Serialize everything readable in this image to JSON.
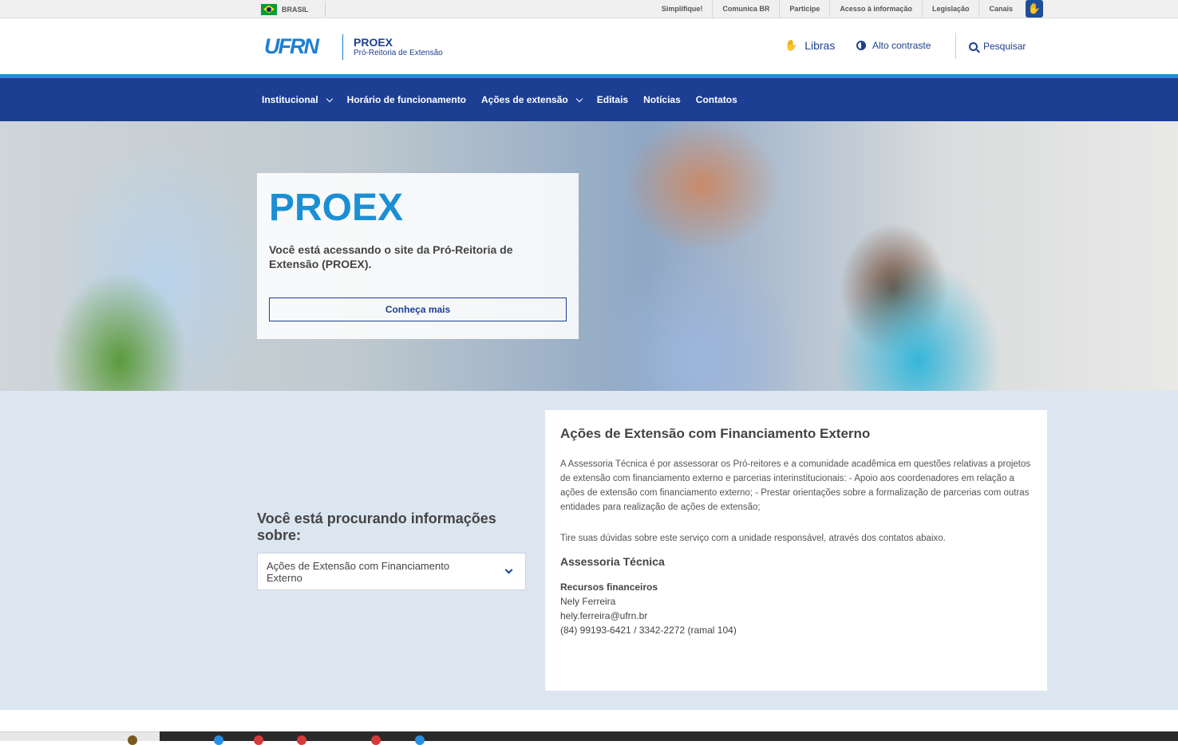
{
  "govbar": {
    "country": "BRASIL",
    "links": [
      "Simplifique!",
      "Comunica BR",
      "Participe",
      "Acesso à informação",
      "Legislação",
      "Canais"
    ]
  },
  "header": {
    "logo": "UFRN",
    "site_title": "PROEX",
    "site_subtitle": "Pró-Reitoria de Extensão",
    "libras": "Libras",
    "contrast": "Alto contraste",
    "search": "Pesquisar"
  },
  "nav": {
    "items": [
      {
        "label": "Institucional",
        "dropdown": true
      },
      {
        "label": "Horário de funcionamento",
        "dropdown": false
      },
      {
        "label": "Ações de extensão",
        "dropdown": true
      },
      {
        "label": "Editais",
        "dropdown": false
      },
      {
        "label": "Notícias",
        "dropdown": false
      },
      {
        "label": "Contatos",
        "dropdown": false
      }
    ]
  },
  "hero": {
    "title": "PROEX",
    "text": "Você está acessando o site da Pró-Reitoria de Extensão (PROEX).",
    "button": "Conheça mais"
  },
  "info": {
    "question": "Você está procurando informações sobre:",
    "select_value": "Ações de Extensão com Financiamento Externo",
    "panel": {
      "title": "Ações de Extensão com Financiamento Externo",
      "description": "A Assessoria Técnica é por assessorar os Pró-reitores e a comunidade acadêmica em questões relativas a projetos de extensão com financiamento externo e parcerias interinstitucionais: - Apoio aos coordenadores em relação a ações de extensão com financiamento externo; - Prestar orientações sobre a formalização de parcerias com outras entidades para realização de ações de extensão;",
      "tip": "Tire suas dúvidas sobre este serviço com a unidade responsável, através dos contatos abaixo.",
      "unit": "Assessoria Técnica",
      "contact": {
        "role": "Recursos financeiros",
        "name": "Nely Ferreira",
        "email": "hely.ferreira@ufrn.br",
        "phone": "(84) 99193-6421 / 3342-2272 (ramal 104)"
      }
    }
  },
  "colors": {
    "nav_blue": "#1c3f94",
    "accent_blue": "#1e8fd8",
    "section_bg": "#dbe6f1"
  }
}
